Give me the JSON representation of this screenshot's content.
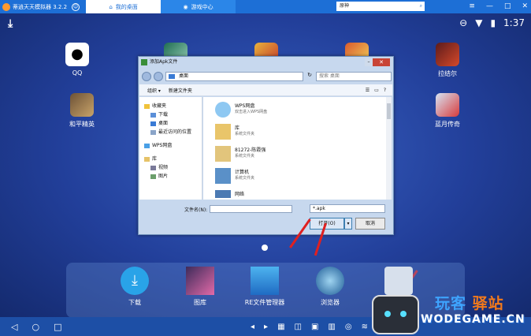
{
  "window": {
    "title": "蒂逍天天模拟器 3.2.2"
  },
  "tabs": [
    {
      "label": "我的桌面",
      "active": true
    },
    {
      "label": "游戏中心",
      "active": false
    }
  ],
  "search": {
    "value": "原神"
  },
  "status": {
    "time": "1:37"
  },
  "desktop_apps": [
    {
      "label": "QQ"
    },
    {
      "label": "和平精英"
    },
    {
      "label": "拉结尔"
    },
    {
      "label": "蓝月传奇"
    }
  ],
  "dialog": {
    "title": "添加Apk文件",
    "address": "桌面",
    "search_placeholder": "搜索 桌面",
    "toolbar": {
      "organize": "组织 ▾",
      "new_folder": "新建文件夹"
    },
    "nav": [
      {
        "label": "收藏夹"
      },
      {
        "label": "下载"
      },
      {
        "label": "桌面"
      },
      {
        "label": "最近访问的位置"
      },
      {
        "label": "WPS网盘"
      },
      {
        "label": "库"
      },
      {
        "label": "视频"
      },
      {
        "label": "图片"
      }
    ],
    "files": [
      {
        "name": "WPS网盘",
        "sub": "双击进入WPS网盘"
      },
      {
        "name": "库",
        "sub": "系统文件夹"
      },
      {
        "name": "81272-陈霞强",
        "sub": "系统文件夹"
      },
      {
        "name": "计算机",
        "sub": "系统文件夹"
      },
      {
        "name": "网络",
        "sub": ""
      }
    ],
    "filename_label": "文件名(N):",
    "filetype": "*.apk",
    "open": "打开(O)",
    "cancel": "取消"
  },
  "dock": [
    {
      "label": "下载"
    },
    {
      "label": "图库"
    },
    {
      "label": "RE文件管理器"
    },
    {
      "label": "浏览器"
    },
    {
      "label": ""
    }
  ],
  "watermark": {
    "line1a": "玩客",
    "line1b": "驿站",
    "line2": "WODEGAME.CN"
  },
  "colors": {
    "accent": "#1d6fd6",
    "arrow": "#e02020"
  }
}
